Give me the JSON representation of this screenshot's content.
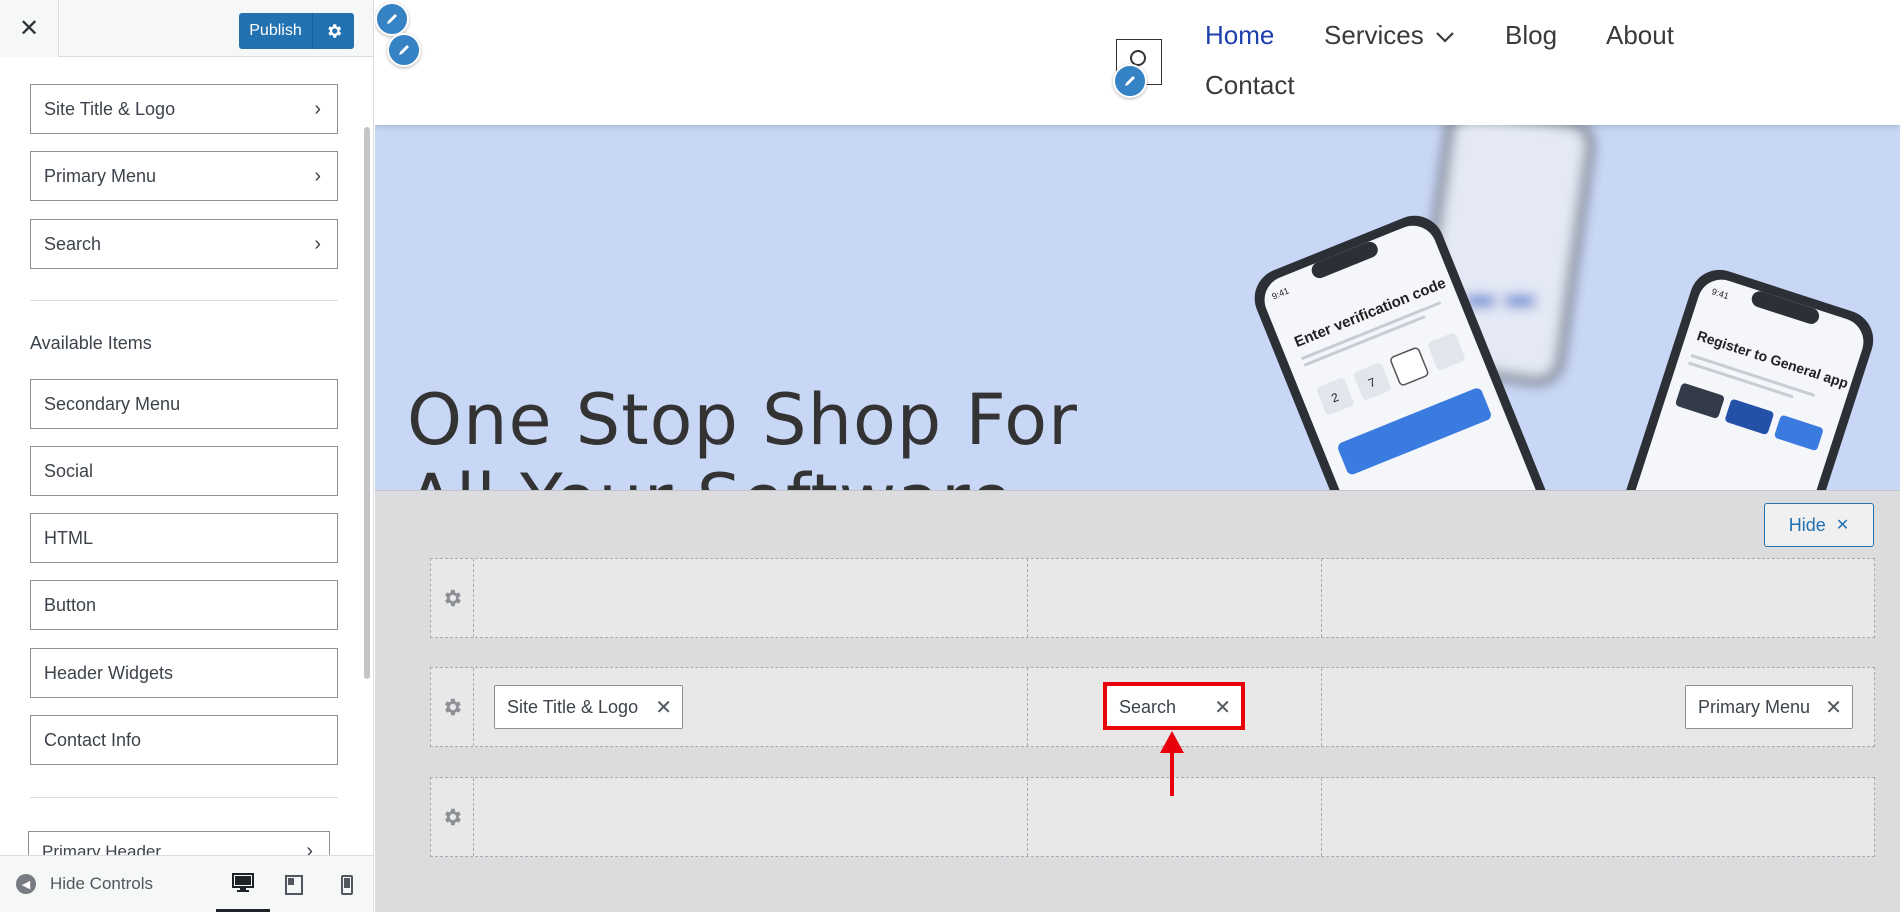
{
  "sidebar": {
    "close_icon": "close-icon",
    "publish_label": "Publish",
    "panel_items": [
      "Site Title & Logo",
      "Primary Menu",
      "Search"
    ],
    "available_title": "Available Items",
    "available_items": [
      "Secondary Menu",
      "Social",
      "HTML",
      "Button",
      "Header Widgets",
      "Contact Info"
    ],
    "bottom_item": "Primary Header",
    "footer": {
      "hide_controls_label": "Hide Controls",
      "devices": [
        "desktop",
        "tablet",
        "mobile"
      ]
    }
  },
  "preview": {
    "nav": [
      "Home",
      "Services",
      "Blog",
      "About",
      "Contact"
    ],
    "hero_title": "One Stop Shop For All Your Software Needs",
    "phone1": {
      "time": "9:41",
      "title": "Enter verification code",
      "code_digits": [
        "2",
        "7"
      ]
    },
    "phone2": {
      "time": "9:41",
      "title": "Register to General app"
    }
  },
  "builder": {
    "hide_label": "Hide",
    "rows": [
      {
        "left": [],
        "center": [],
        "right": []
      },
      {
        "left": [
          "Site Title & Logo"
        ],
        "center": [
          "Search"
        ],
        "right": [
          "Primary Menu"
        ]
      },
      {
        "left": [],
        "center": [],
        "right": []
      }
    ]
  },
  "colors": {
    "accent": "#2271b1",
    "nav_active": "#1e40af",
    "hero_bg": "#c8d7f5",
    "annotation_red": "#e8000b"
  }
}
